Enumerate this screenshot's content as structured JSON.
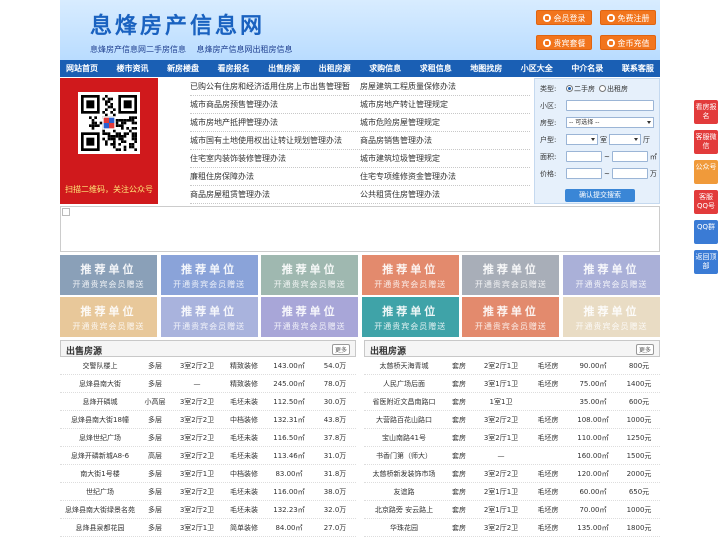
{
  "header": {
    "logo": "息烽房产信息网",
    "subtitle": [
      "息烽房产信息网二手房信息",
      "息烽房产信息网出租房信息"
    ],
    "buttons": [
      "会员登录",
      "免费注册",
      "贵宾套餐",
      "金币充值"
    ]
  },
  "nav": [
    "网站首页",
    "楼市资讯",
    "新房楼盘",
    "看房报名",
    "出售房源",
    "出租房源",
    "求购信息",
    "求租信息",
    "地图找房",
    "小区大全",
    "中介名录",
    "联系客服"
  ],
  "qr": {
    "caption": "扫描二维码，关注公众号"
  },
  "links": [
    [
      "已购公有住房和经济适用住房上市出售管理暂",
      "房屋建筑工程质量保修办法"
    ],
    [
      "城市商品房预售管理办法",
      "城市房地产转让管理规定"
    ],
    [
      "城市房地产抵押管理办法",
      "城市危险房屋管理规定"
    ],
    [
      "城市国有土地使用权出让转让规划管理办法",
      "商品房销售管理办法"
    ],
    [
      "住宅室内装饰装修管理办法",
      "城市建筑垃圾管理规定"
    ],
    [
      "廉租住房保障办法",
      "住宅专项维修资金管理办法"
    ],
    [
      "商品房屋租赁管理办法",
      "公共租赁住房管理办法"
    ]
  ],
  "search": {
    "type_label": "类型:",
    "type_options": [
      "二手房",
      "出租房"
    ],
    "community_label": "小区:",
    "property_label": "房型:",
    "property_select": "-- 可选择 --",
    "layout_label": "户型:",
    "layout_units": [
      "室",
      "厅"
    ],
    "area_label": "面积:",
    "area_unit": "㎡",
    "price_label": "价格:",
    "price_unit": "万",
    "range_sep": "~",
    "submit": "确认提交搜索"
  },
  "ads": {
    "line1": "推荐单位",
    "line2": "开通贵宾会员赠送"
  },
  "ad_colors": [
    "#8aa0b8",
    "#8aa3d9",
    "#9fb8b0",
    "#e38a6d",
    "#a8aeb8",
    "#aab0d8",
    "#e8c89a",
    "#a9b3dd",
    "#a8a6d8",
    "#3fa3a8",
    "#e38a6d",
    "#e9dcc4"
  ],
  "sale": {
    "title": "出售房源",
    "more": "更多",
    "rows": [
      [
        "交警队楼上",
        "多层",
        "3室2厅2卫",
        "精致装修",
        "143.00㎡",
        "54.0万"
      ],
      [
        "息烽县南大街",
        "多层",
        "—",
        "精致装修",
        "245.00㎡",
        "78.0万"
      ],
      [
        "息烽开磷城",
        "小高层",
        "3室2厅2卫",
        "毛坯未装",
        "112.50㎡",
        "30.0万"
      ],
      [
        "息烽县南大街18幢",
        "多层",
        "3室2厅2卫",
        "中档装修",
        "132.31㎡",
        "43.8万"
      ],
      [
        "息烽世纪广场",
        "多层",
        "3室2厅2卫",
        "毛坯未装",
        "116.50㎡",
        "37.8万"
      ],
      [
        "息烽开磷新城A8-6",
        "高层",
        "3室2厅2卫",
        "毛坯未装",
        "113.46㎡",
        "31.0万"
      ],
      [
        "南大街1号楼",
        "多层",
        "3室2厅1卫",
        "中档装修",
        "83.00㎡",
        "31.8万"
      ],
      [
        "世纪广场",
        "多层",
        "3室2厅2卫",
        "毛坯未装",
        "116.00㎡",
        "38.0万"
      ],
      [
        "息烽县南大街绿景名苑",
        "多层",
        "3室2厅2卫",
        "毛坯未装",
        "132.23㎡",
        "32.0万"
      ],
      [
        "息烽县泉都花园",
        "多层",
        "3室2厅1卫",
        "简单装修",
        "84.00㎡",
        "27.0万"
      ]
    ]
  },
  "rent": {
    "title": "出租房源",
    "more": "更多",
    "rows": [
      [
        "太慈桥天海青城",
        "套房",
        "2室2厅1卫",
        "毛坯房",
        "90.00㎡",
        "800元"
      ],
      [
        "人民广场后面",
        "套房",
        "3室1厅1卫",
        "毛坯房",
        "75.00㎡",
        "1400元"
      ],
      [
        "省医附近文昌南路口",
        "套房",
        "1室1卫",
        "",
        "35.00㎡",
        "600元"
      ],
      [
        "大营路百花山路口",
        "套房",
        "3室2厅2卫",
        "毛坯房",
        "108.00㎡",
        "1000元"
      ],
      [
        "宝山南路41号",
        "套房",
        "3室2厅1卫",
        "毛坯房",
        "110.00㎡",
        "1250元"
      ],
      [
        "书香门第（师大）",
        "套房",
        "—",
        "",
        "160.00㎡",
        "1500元"
      ],
      [
        "太慈桥新发装饰市场",
        "套房",
        "3室2厅2卫",
        "毛坯房",
        "120.00㎡",
        "2000元"
      ],
      [
        "友谊路",
        "套房",
        "2室1厅1卫",
        "毛坯房",
        "60.00㎡",
        "650元"
      ],
      [
        "北京路旁 安云路上",
        "套房",
        "2室1厅1卫",
        "毛坯房",
        "70.00㎡",
        "1000元"
      ],
      [
        "华珠花园",
        "套房",
        "3室2厅2卫",
        "毛坯房",
        "135.00㎡",
        "1800元"
      ]
    ]
  },
  "side": [
    {
      "label": "看房报名",
      "color": "#e23b3b"
    },
    {
      "label": "客服微信",
      "color": "#e23b3b"
    },
    {
      "label": "公众号",
      "color": "#f09a3a"
    },
    {
      "label": "客服QQ号",
      "color": "#e23b3b"
    },
    {
      "label": "QQ群",
      "color": "#3a7bd5"
    },
    {
      "label": "返回顶部",
      "color": "#3a7bd5"
    }
  ]
}
